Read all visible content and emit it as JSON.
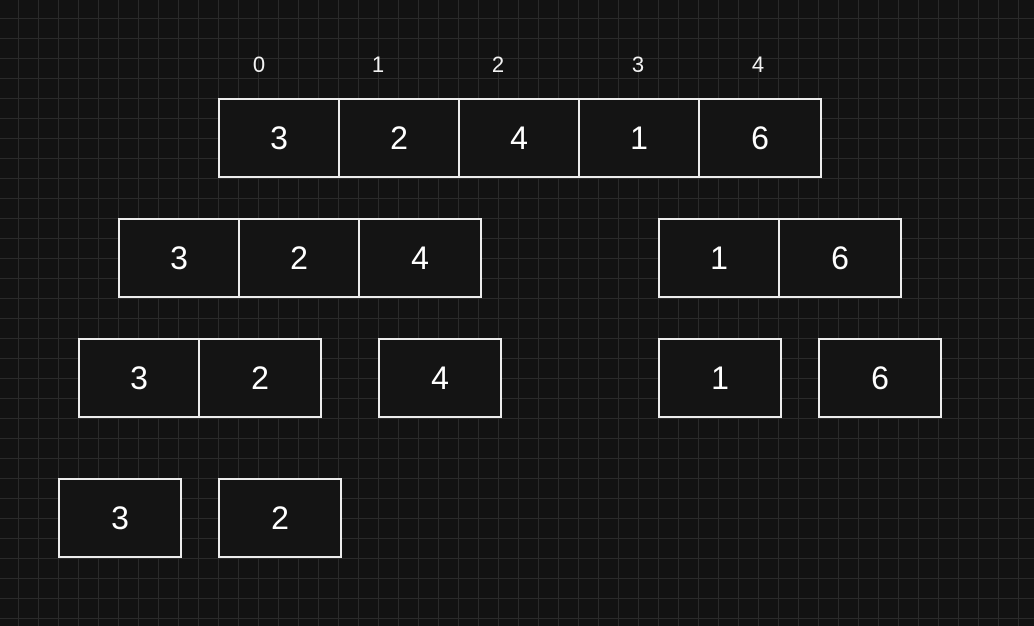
{
  "indices": [
    "0",
    "1",
    "2",
    "3",
    "4"
  ],
  "levels": [
    {
      "groups": [
        {
          "values": [
            "3",
            "2",
            "4",
            "1",
            "6"
          ]
        }
      ]
    },
    {
      "groups": [
        {
          "values": [
            "3",
            "2",
            "4"
          ]
        },
        {
          "values": [
            "1",
            "6"
          ]
        }
      ]
    },
    {
      "groups": [
        {
          "values": [
            "3",
            "2"
          ]
        },
        {
          "values": [
            "4"
          ]
        },
        {
          "values": [
            "1"
          ]
        },
        {
          "values": [
            "6"
          ]
        }
      ]
    },
    {
      "groups": [
        {
          "values": [
            "3"
          ]
        },
        {
          "values": [
            "2"
          ]
        }
      ]
    }
  ],
  "colors": {
    "background": "#121212",
    "grid": "#2a2a2a",
    "border": "#ececec",
    "text": "#ffffff"
  }
}
